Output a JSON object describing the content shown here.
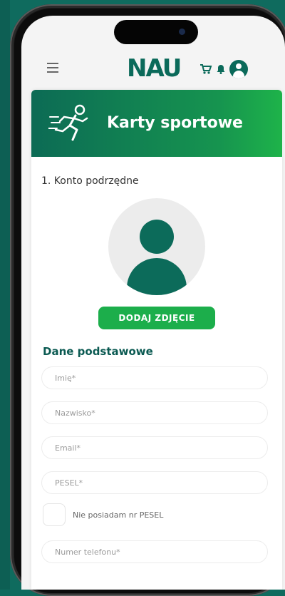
{
  "header": {
    "logo_text": "NAU"
  },
  "banner": {
    "title": "Karty sportowe"
  },
  "section": {
    "step_label": "1. Konto podrzędne"
  },
  "photo": {
    "add_button_label": "DODAJ ZDJĘCIE"
  },
  "form": {
    "heading": "Dane podstawowe",
    "fields": [
      {
        "placeholder": "Imię*"
      },
      {
        "placeholder": "Nazwisko*"
      },
      {
        "placeholder": "Email*"
      },
      {
        "placeholder": "PESEL*"
      },
      {
        "placeholder": "Numer telefonu*"
      }
    ],
    "no_pesel_label": "Nie posiadam nr PESEL"
  },
  "colors": {
    "brand_dark": "#0b6a5a",
    "brand_green": "#1cae4b",
    "background": "#0f6b5e"
  },
  "icons": [
    "hamburger-icon",
    "cart-icon",
    "bell-icon",
    "user-avatar-icon",
    "runner-icon"
  ]
}
